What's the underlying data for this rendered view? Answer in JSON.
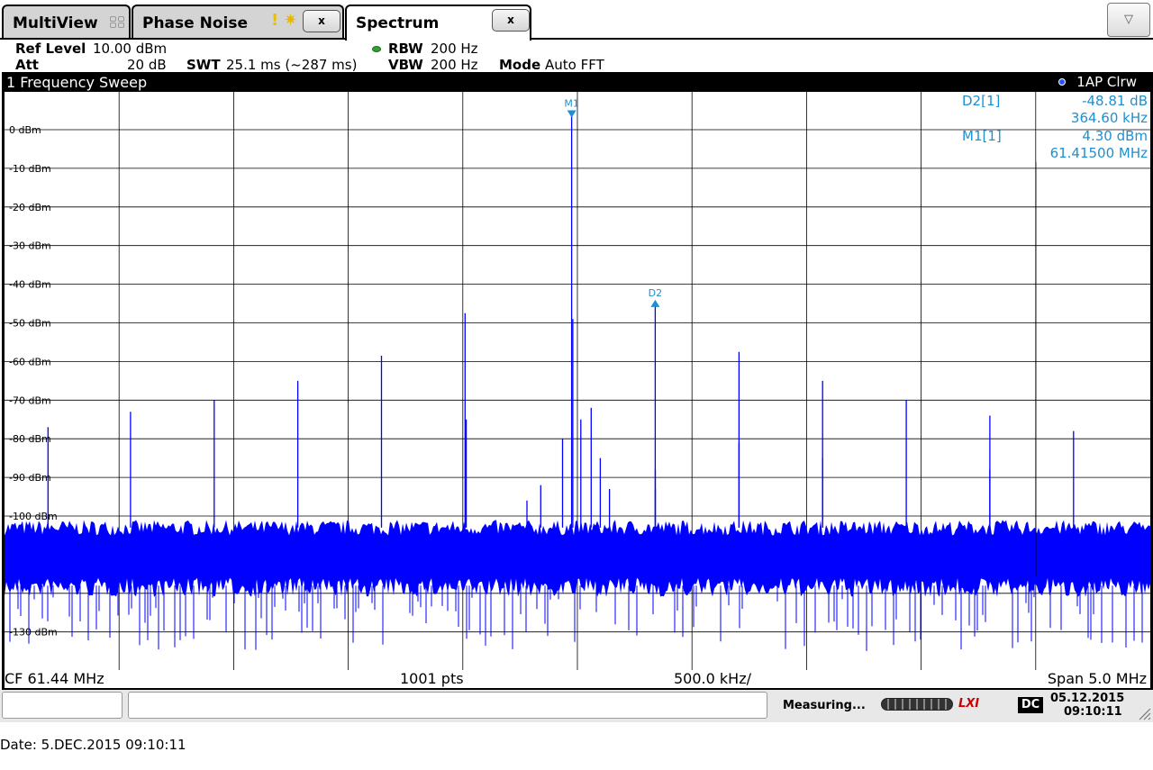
{
  "tabs": [
    {
      "label": "MultiView"
    },
    {
      "label": "Phase Noise",
      "close_label": "x"
    },
    {
      "label": "Spectrum",
      "close_label": "x"
    }
  ],
  "dropdown_icon": "▽",
  "settings": {
    "ref_level_label": "Ref Level",
    "ref_level_value": "10.00 dBm",
    "att_label": "Att",
    "att_value": "20 dB",
    "swt_label": "SWT",
    "swt_value": "25.1 ms (~287 ms)",
    "rbw_label": "RBW",
    "rbw_value": "200 Hz",
    "vbw_label": "VBW",
    "vbw_value": "200 Hz",
    "mode_label": "Mode",
    "mode_value": "Auto FFT"
  },
  "window": {
    "title": "1 Frequency Sweep",
    "trace_label": "1AP Clrw"
  },
  "marker_table": [
    {
      "name": "D2[1]",
      "level": "-48.81 dB",
      "freq": "364.60 kHz"
    },
    {
      "name": "M1[1]",
      "level": "4.30 dBm",
      "freq": "61.41500 MHz"
    }
  ],
  "footer": {
    "cf": "CF 61.44 MHz",
    "pts": "1001 pts",
    "div": "500.0 kHz/",
    "span": "Span 5.0 MHz"
  },
  "status": {
    "measuring": "Measuring...",
    "dc": "DC",
    "date": "05.12.2015",
    "time": "09:10:11",
    "lxi": "LXI"
  },
  "date_line": "Date: 5.DEC.2015  09:10:11",
  "colors": {
    "trace": "#0000ff",
    "marker": "#1e90d0",
    "grid": "#000000",
    "plot_bg": "#ffffff"
  },
  "chart_data": {
    "type": "line",
    "title": "1 Frequency Sweep",
    "xlabel": "",
    "ylabel": "",
    "x_unit": "MHz",
    "y_unit": "dBm",
    "xlim": [
      58.94,
      63.94
    ],
    "ylim": [
      -140,
      10
    ],
    "y_ticks": [
      {
        "value": 0,
        "label": "0 dBm"
      },
      {
        "value": -10,
        "label": "-10 dBm"
      },
      {
        "value": -20,
        "label": "-20 dBm"
      },
      {
        "value": -30,
        "label": "-30 dBm"
      },
      {
        "value": -40,
        "label": "-40 dBm"
      },
      {
        "value": -50,
        "label": "-50 dBm"
      },
      {
        "value": -60,
        "label": "-60 dBm"
      },
      {
        "value": -70,
        "label": "-70 dBm"
      },
      {
        "value": -80,
        "label": "-80 dBm"
      },
      {
        "value": -90,
        "label": "-90 dBm"
      },
      {
        "value": -100,
        "label": "-100 dBm"
      },
      {
        "value": -130,
        "label": "-130 dBm"
      }
    ],
    "x_divisions": 10,
    "grid": true,
    "noise_floor": {
      "top": -103,
      "bottom": -116,
      "min_spike": -135
    },
    "series": [
      {
        "points": [
          {
            "x": 59.13,
            "y": -77
          },
          {
            "x": 59.49,
            "y": -73
          },
          {
            "x": 59.855,
            "y": -70
          },
          {
            "x": 60.22,
            "y": -65
          },
          {
            "x": 60.585,
            "y": -58.5
          },
          {
            "x": 60.95,
            "y": -47.5
          },
          {
            "x": 60.955,
            "y": -75
          },
          {
            "x": 61.22,
            "y": -96
          },
          {
            "x": 61.28,
            "y": -92
          },
          {
            "x": 61.375,
            "y": -80
          },
          {
            "x": 61.415,
            "y": 4.3
          },
          {
            "x": 61.42,
            "y": -49
          },
          {
            "x": 61.455,
            "y": -75
          },
          {
            "x": 61.5,
            "y": -72
          },
          {
            "x": 61.54,
            "y": -85
          },
          {
            "x": 61.58,
            "y": -93
          },
          {
            "x": 61.78,
            "y": -93
          },
          {
            "x": 61.7796,
            "y": -44.5
          },
          {
            "x": 61.78,
            "y": -88
          },
          {
            "x": 62.145,
            "y": -57.5
          },
          {
            "x": 62.145,
            "y": -81
          },
          {
            "x": 62.51,
            "y": -65
          },
          {
            "x": 62.51,
            "y": -85
          },
          {
            "x": 62.875,
            "y": -70
          },
          {
            "x": 63.24,
            "y": -74
          },
          {
            "x": 63.24,
            "y": -88
          },
          {
            "x": 63.605,
            "y": -78
          }
        ]
      }
    ],
    "markers": [
      {
        "label": "M1",
        "x": 61.415,
        "y": 4.3
      },
      {
        "label": "D2",
        "x": 61.7796,
        "y": -44.5
      }
    ]
  }
}
